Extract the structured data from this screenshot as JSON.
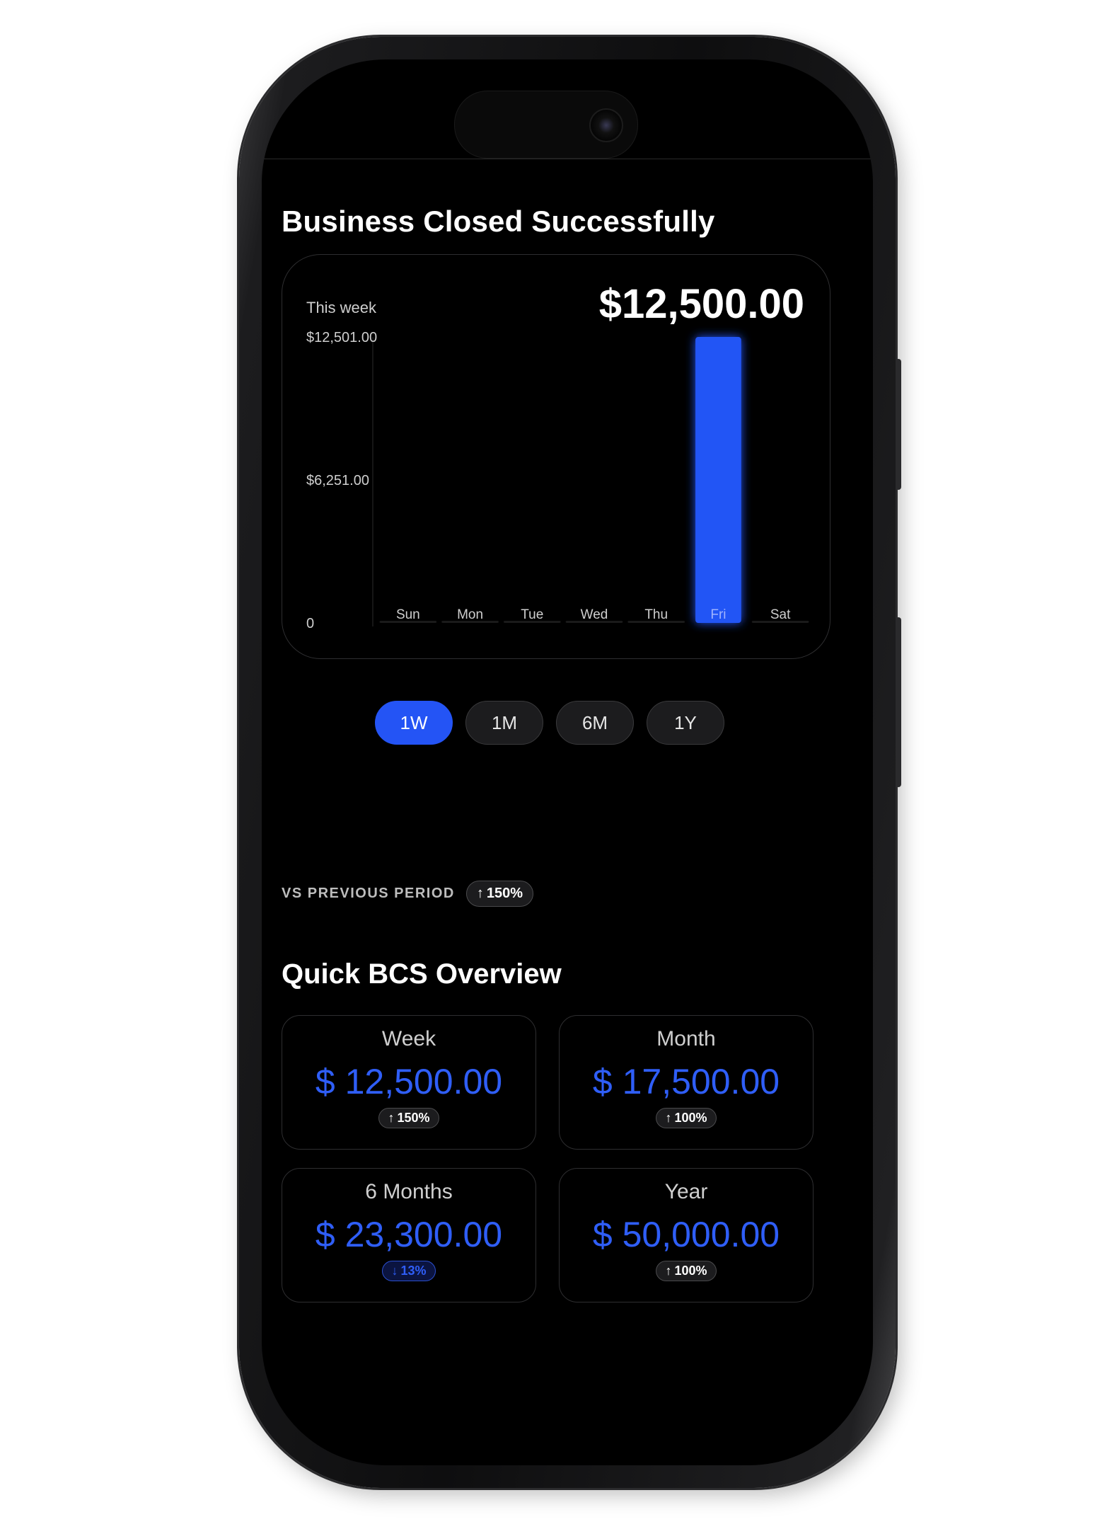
{
  "header": {
    "title": "Business Closed Successfully"
  },
  "chart": {
    "period_label": "This week",
    "total": "$12,500.00",
    "y_tick_labels": [
      "$12,501.00",
      "$6,251.00",
      "0"
    ]
  },
  "chart_data": {
    "type": "bar",
    "title": "",
    "categories": [
      "Sun",
      "Mon",
      "Tue",
      "Wed",
      "Thu",
      "Fri",
      "Sat"
    ],
    "values": [
      0,
      0,
      0,
      0,
      0,
      12500,
      0
    ],
    "ylim": [
      0,
      12501
    ],
    "y_ticks": [
      0,
      6251,
      12501
    ],
    "highlight_category": "Fri",
    "bar_color": "#2454f5",
    "grid": false
  },
  "range": {
    "options": [
      "1W",
      "1M",
      "6M",
      "1Y"
    ],
    "selected": "1W"
  },
  "comparison": {
    "label": "VS PREVIOUS PERIOD",
    "arrow": "↑",
    "change": "150%"
  },
  "overview": {
    "title": "Quick BCS Overview",
    "cards": [
      {
        "label": "Week",
        "value": "$ 12,500.00",
        "arrow": "↑",
        "change": "150%",
        "direction": "up"
      },
      {
        "label": "Month",
        "value": "$ 17,500.00",
        "arrow": "↑",
        "change": "100%",
        "direction": "up"
      },
      {
        "label": "6 Months",
        "value": "$ 23,300.00",
        "arrow": "↓",
        "change": "13%",
        "direction": "down"
      },
      {
        "label": "Year",
        "value": "$ 50,000.00",
        "arrow": "↑",
        "change": "100%",
        "direction": "up"
      }
    ]
  },
  "colors": {
    "accent": "#2454f5",
    "accent_text": "#2f5ef7",
    "background": "#000000",
    "card_border": "#2e2e30"
  }
}
